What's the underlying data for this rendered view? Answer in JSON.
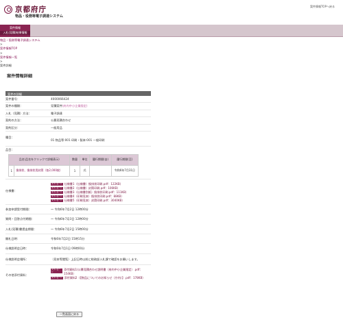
{
  "header": {
    "logo_text": "京都府庁",
    "system_name": "物品・役務等電子調達システム",
    "top_link": "案件情報TOPへ戻る"
  },
  "menu": {
    "label_line1": "案件情報",
    "label_line2": "入札(見積)結果情報"
  },
  "breadcrumb": {
    "item1": "物品・役務等電子調達システム",
    "sep": ">",
    "item2": "案件情報TOP",
    "item3": "案件情報一覧",
    "item4": "案件詳細"
  },
  "page_title": "案件情報詳細",
  "detail": {
    "section_title": "案件の詳細",
    "rows": {
      "case_number": {
        "label": "案件番号：",
        "value": "4000066424"
      },
      "case_type": {
        "label": "案件の種類：",
        "value": "見積案件",
        "note": "(府内中小企業限定)"
      },
      "bid_method": {
        "label": "入札（見積）方法：",
        "value": "電子調達"
      },
      "contract_method": {
        "label": "契約の方法：",
        "value": "公募見積合わせ"
      },
      "contract_class": {
        "label": "契約区分：",
        "value": "一般用品"
      },
      "category": {
        "label": "種目：",
        "value": "01 物品等:001 印刷・製本:001 一般印刷"
      },
      "items_label": {
        "label": "品目："
      }
    },
    "items_table": {
      "headers": [
        "品名(品名をクリックで詳細表示)",
        "数量",
        "単位",
        "履行期間(自)",
        "履行期間(至)"
      ],
      "row": {
        "no": "1",
        "name": "換排状、換排状用封筒（各2,000枚）",
        "qty": "1",
        "unit": "式",
        "from": "",
        "to": "令和6年7月31日"
      }
    },
    "spec": {
      "label": "仕様書：",
      "dl_label": "ダウンロード",
      "files": [
        "仕様書1（仕様書）換排状印刷.pdf：122KB）",
        "仕様書2（仕様書）封筒印刷.pdf：106KB）",
        "仕様書3（仕様書別紙）換排状印刷.pdf：111KB）",
        "仕様書4（印刷見本）換排状印刷.pdf：88KB）",
        "仕様書5（印刷見本）封筒印刷.pdf：3040KB）"
      ]
    },
    "dates": [
      {
        "label": "参加申請受付期間：",
        "value": "〜 令和6年7月2日 12時00分"
      },
      {
        "label": "質問・回答点付期間：",
        "value": "〜 令和6年7月3日 12時00分"
      },
      {
        "label": "入札(見積)書提出期間：",
        "value": "〜 令和6年7月2日 15時00分"
      },
      {
        "label": "開札日時：",
        "value": "令和6年7月2日 15時15分"
      },
      {
        "label": "仕様説明会日時：",
        "value": "令和6年7月1日 09時00分"
      },
      {
        "label": "仕様説明会場所：",
        "value": "（見本等閲覧）上記日時以前に総務部入札課で確認をお願いします。"
      }
    ],
    "other": {
      "label": "その他添付資料：",
      "dl_label": "ダウンロード",
      "files": [
        "添付資料1(公募見積合わせ説明書（府内中小企業限定）.pdf：154KB）",
        "添付資料2（【物品についてのお知らせ（庁内）】.pdf：178KB）"
      ]
    }
  },
  "back_button": "一覧画面に戻る"
}
